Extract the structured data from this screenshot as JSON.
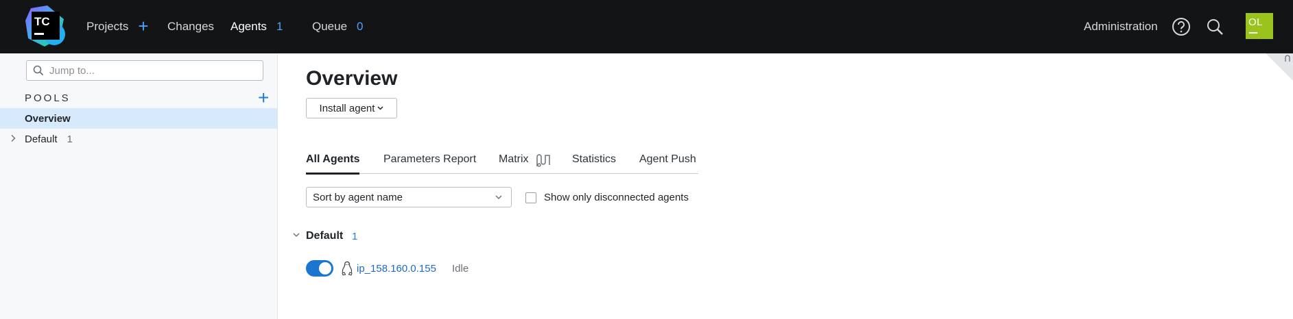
{
  "app": {
    "logo_text": "TC"
  },
  "header": {
    "nav": [
      {
        "label": "Projects"
      },
      {
        "label": "Changes"
      },
      {
        "label": "Agents",
        "count": "1"
      },
      {
        "label": "Queue",
        "count": "0"
      }
    ],
    "administration": "Administration",
    "avatar_initials": "OL",
    "icons": [
      "help-icon",
      "search-icon"
    ]
  },
  "sidebar": {
    "search_placeholder": "Jump to...",
    "pools_label": "POOLS",
    "items": [
      {
        "label": "Overview",
        "selected": true
      },
      {
        "label": "Default",
        "count": "1"
      }
    ]
  },
  "main": {
    "title": "Overview",
    "install_button": "Install agent",
    "tabs": [
      {
        "label": "All Agents",
        "active": true
      },
      {
        "label": "Parameters Report"
      },
      {
        "label": "Matrix"
      },
      {
        "label": "Statistics"
      },
      {
        "label": "Agent Push"
      }
    ],
    "sort_select": "Sort by agent name",
    "disconnected_checkbox_label": "Show only disconnected agents",
    "group": {
      "name": "Default",
      "count": "1"
    },
    "agents": [
      {
        "name": "ip_158.160.0.155",
        "status": "Idle",
        "enabled": true,
        "os_icon": "linux-icon"
      }
    ]
  },
  "colors": {
    "topbar_bg": "#121416",
    "accent": "#1b76d0",
    "avatar_bg": "#9ac31c",
    "sidebar_selected": "#d6eafb"
  }
}
